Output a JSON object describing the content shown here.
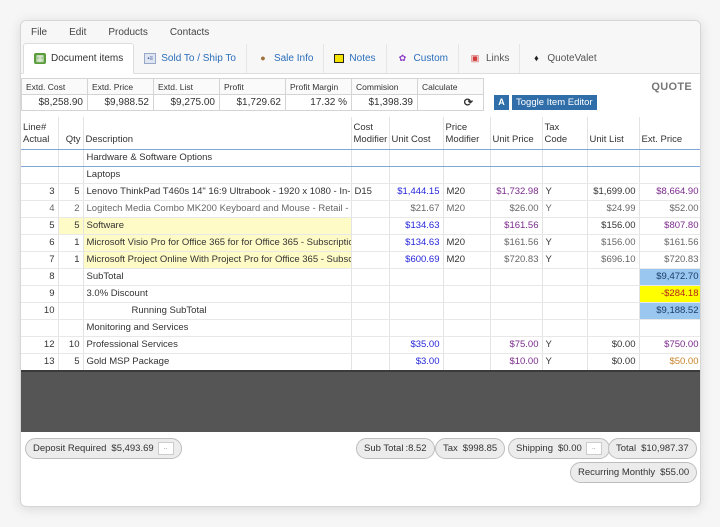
{
  "menu": [
    "File",
    "Edit",
    "Products",
    "Contacts"
  ],
  "tabs": [
    {
      "label": "Document items",
      "icon": "document-items-icon",
      "active": true
    },
    {
      "label": "Sold To / Ship To",
      "icon": "address-card-icon",
      "active": false
    },
    {
      "label": "Sale Info",
      "icon": "sale-info-icon",
      "active": false
    },
    {
      "label": "Notes",
      "icon": "notes-icon",
      "active": false
    },
    {
      "label": "Custom",
      "icon": "custom-icon",
      "active": false
    },
    {
      "label": "Links",
      "icon": "links-icon",
      "active": false
    },
    {
      "label": "QuoteValet",
      "icon": "quotevalet-icon",
      "active": false
    }
  ],
  "summary": {
    "headers": [
      "Extd. Cost",
      "Extd. Price",
      "Extd. List",
      "Profit",
      "Profit Margin",
      "Commision",
      "Calculate"
    ],
    "values": [
      "$8,258.90",
      "$9,988.52",
      "$9,275.00",
      "$1,729.62",
      "17.32 %",
      "$1,398.39",
      ""
    ]
  },
  "doc_type": "QUOTE",
  "buttons": {
    "a_label": "A",
    "toggle_label": "Toggle Item Editor"
  },
  "columns": {
    "line": [
      "Line#",
      "Actual"
    ],
    "qty": "Qty",
    "description": "Description",
    "cost_modifier": [
      "Cost",
      "Modifier"
    ],
    "unit_cost": "Unit Cost",
    "price_modifier": [
      "Price",
      "Modifier"
    ],
    "unit_price": "Unit Price",
    "tax_code": "Tax Code",
    "unit_list": "Unit List",
    "ext_price": "Ext. Price"
  },
  "rows": [
    {
      "line": "",
      "qty": "",
      "desc": "Hardware & Software Options",
      "cmod": "",
      "ucost": "",
      "pmod": "",
      "uprice": "",
      "tax": "",
      "ulist": "",
      "ext": ""
    },
    {
      "line": "",
      "qty": "",
      "desc": "Laptops",
      "cmod": "",
      "ucost": "",
      "pmod": "",
      "uprice": "",
      "tax": "",
      "ulist": "",
      "ext": ""
    },
    {
      "line": "3",
      "qty": "5",
      "desc": "Lenovo ThinkPad T460s 14\" 16:9 Ultrabook - 1920 x 1080 - In-",
      "cmod": "D15",
      "ucost": "$1,444.15",
      "pmod": "M20",
      "uprice": "$1,732.98",
      "tax": "Y",
      "ulist": "$1,699.00",
      "ext": "$8,664.90"
    },
    {
      "line": "4",
      "qty": "2",
      "desc": "Logitech Media Combo MK200 Keyboard and Mouse - Retail -",
      "cmod": "",
      "ucost": "$21.67",
      "pmod": "M20",
      "uprice": "$26.00",
      "tax": "Y",
      "ulist": "$24.99",
      "ext": "$52.00"
    },
    {
      "line": "5",
      "qty": "5",
      "desc": "Software",
      "cmod": "",
      "ucost": "$134.63",
      "pmod": "",
      "uprice": "$161.56",
      "tax": "",
      "ulist": "$156.00",
      "ext": "$807.80"
    },
    {
      "line": "6",
      "qty": "1",
      "desc": "Microsoft Visio Pro for Office 365 for for Office 365 - Subscriptic",
      "cmod": "",
      "ucost": "$134.63",
      "pmod": "M20",
      "uprice": "$161.56",
      "tax": "Y",
      "ulist": "$156.00",
      "ext": "$161.56"
    },
    {
      "line": "7",
      "qty": "1",
      "desc": "Microsoft Project Online With Project Pro for Office 365 - Subsc",
      "cmod": "",
      "ucost": "$600.69",
      "pmod": "M20",
      "uprice": "$720.83",
      "tax": "Y",
      "ulist": "$696.10",
      "ext": "$720.83"
    },
    {
      "line": "8",
      "qty": "",
      "desc": "SubTotal",
      "cmod": "",
      "ucost": "",
      "pmod": "",
      "uprice": "",
      "tax": "",
      "ulist": "",
      "ext": "$9,472.70"
    },
    {
      "line": "9",
      "qty": "",
      "desc": "3.0% Discount",
      "cmod": "",
      "ucost": "",
      "pmod": "",
      "uprice": "",
      "tax": "",
      "ulist": "",
      "ext": "-$284.18"
    },
    {
      "line": "10",
      "qty": "",
      "desc": "Running SubTotal",
      "cmod": "",
      "ucost": "",
      "pmod": "",
      "uprice": "",
      "tax": "",
      "ulist": "",
      "ext": "$9,188.52"
    },
    {
      "line": "",
      "qty": "",
      "desc": "Monitoring and Services",
      "cmod": "",
      "ucost": "",
      "pmod": "",
      "uprice": "",
      "tax": "",
      "ulist": "",
      "ext": ""
    },
    {
      "line": "12",
      "qty": "10",
      "desc": "Professional Services",
      "cmod": "",
      "ucost": "$35.00",
      "pmod": "",
      "uprice": "$75.00",
      "tax": "Y",
      "ulist": "$0.00",
      "ext": "$750.00"
    },
    {
      "line": "13",
      "qty": "5",
      "desc": "Gold MSP Package",
      "cmod": "",
      "ucost": "$3.00",
      "pmod": "",
      "uprice": "$10.00",
      "tax": "Y",
      "ulist": "$0.00",
      "ext": "$50.00"
    }
  ],
  "footer": {
    "deposit": {
      "label": "Deposit Required",
      "value": "$5,493.69",
      "more": ".."
    },
    "subtotal": {
      "label": "Sub Total",
      "value": ":8.52"
    },
    "tax": {
      "label": "Tax",
      "value": "$998.85"
    },
    "shipping": {
      "label": "Shipping",
      "value": "$0.00",
      "more": ".."
    },
    "total": {
      "label": "Total",
      "value": "$10,987.37"
    },
    "recurring": {
      "label": "Recurring Monthly",
      "value": "$55.00"
    }
  },
  "colors": {
    "accent_button": "#2f6ea8",
    "tab_link": "#2a6ebb",
    "subtotal_highlight": "#99c7f0",
    "discount_highlight": "#ffff00",
    "selected_row": "#fffbc6"
  }
}
